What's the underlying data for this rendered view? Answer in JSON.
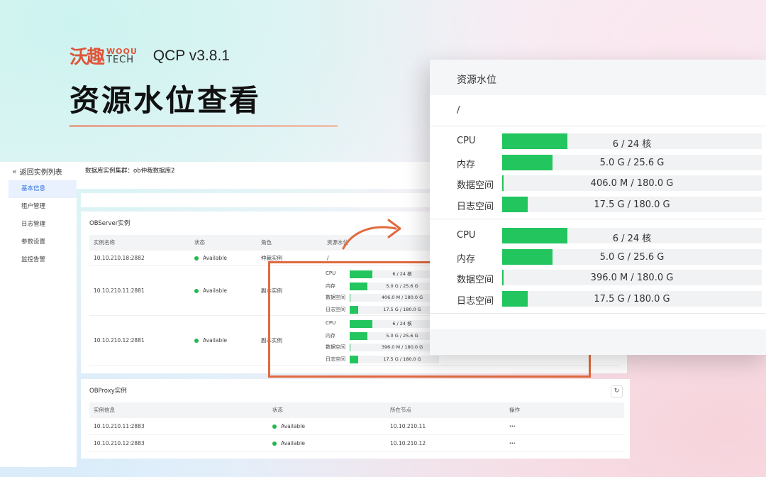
{
  "hero": {
    "brand_cn": "沃趣",
    "brand_en_top": "WOQU",
    "brand_en_bottom": "TECH",
    "version": "QCP v3.8.1",
    "title": "资源水位查看"
  },
  "sidebar": {
    "back_label": "返回实例列表",
    "items": [
      {
        "label": "基本信息",
        "active": true
      },
      {
        "label": "租户管理",
        "active": false
      },
      {
        "label": "日志管理",
        "active": false
      },
      {
        "label": "参数设置",
        "active": false
      },
      {
        "label": "监控告警",
        "active": false
      }
    ]
  },
  "main": {
    "cluster_title": "数据库实例集群：ob仲裁数据库2"
  },
  "obs": {
    "title": "OBServer实例",
    "headers": [
      "实例名称",
      "状态",
      "角色",
      "资源水位"
    ],
    "rows": [
      {
        "name": "10.10.210.18:2882",
        "status": "Available",
        "role": "仲裁实例",
        "slash": "/"
      },
      {
        "name": "10.10.210.11:2881",
        "status": "Available",
        "role": "副本实例"
      },
      {
        "name": "10.10.210.12:2881",
        "status": "Available",
        "role": "副本实例"
      }
    ],
    "resources": [
      [
        {
          "label": "CPU",
          "value": "6 / 24 核",
          "ratio": 0.25
        },
        {
          "label": "内存",
          "value": "5.0 G / 25.6 G",
          "ratio": 0.195
        },
        {
          "label": "数据空间",
          "value": "406.0 M / 180.0 G",
          "ratio": 0.006
        },
        {
          "label": "日志空间",
          "value": "17.5 G / 180.0 G",
          "ratio": 0.097
        }
      ],
      [
        {
          "label": "CPU",
          "value": "6 / 24 核",
          "ratio": 0.25
        },
        {
          "label": "内存",
          "value": "5.0 G / 25.6 G",
          "ratio": 0.195
        },
        {
          "label": "数据空间",
          "value": "396.0 M / 180.0 G",
          "ratio": 0.006
        },
        {
          "label": "日志空间",
          "value": "17.5 G / 180.0 G",
          "ratio": 0.097
        }
      ]
    ]
  },
  "obp": {
    "title": "OBProxy实例",
    "refresh_icon": "↻",
    "headers": [
      "实例信息",
      "状态",
      "所在节点",
      "操作"
    ],
    "rows": [
      {
        "name": "10.10.210.11:2883",
        "status": "Available",
        "node": "10.10.210.11",
        "op": "···"
      },
      {
        "name": "10.10.210.12:2883",
        "status": "Available",
        "node": "10.10.210.12",
        "op": "···"
      }
    ]
  },
  "zoom": {
    "header": "资源水位",
    "slash": "/"
  },
  "colors": {
    "accent_orange": "#e06a3e",
    "bar_green": "#22c55e",
    "status_green": "#22b84b",
    "active_blue": "#2f6ee0"
  }
}
